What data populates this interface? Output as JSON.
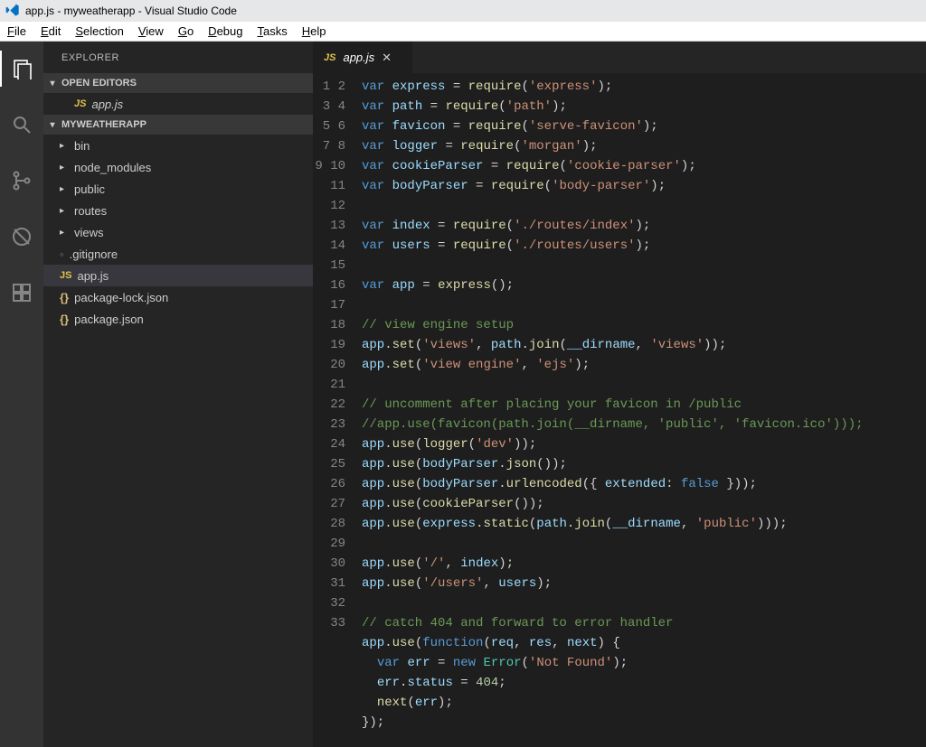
{
  "window": {
    "title": "app.js - myweatherapp - Visual Studio Code"
  },
  "menubar": [
    "File",
    "Edit",
    "Selection",
    "View",
    "Go",
    "Debug",
    "Tasks",
    "Help"
  ],
  "activitybar": [
    "explorer",
    "search",
    "git",
    "debug",
    "extensions"
  ],
  "sidebar": {
    "title": "EXPLORER",
    "open_editors_label": "OPEN EDITORS",
    "open_editors": [
      {
        "icon": "JS",
        "name": "app.js"
      }
    ],
    "project_label": "MYWEATHERAPP",
    "tree": [
      {
        "kind": "folder",
        "name": "bin"
      },
      {
        "kind": "folder",
        "name": "node_modules"
      },
      {
        "kind": "folder",
        "name": "public"
      },
      {
        "kind": "folder",
        "name": "routes"
      },
      {
        "kind": "folder",
        "name": "views"
      },
      {
        "kind": "file",
        "name": ".gitignore",
        "icon": "dot"
      },
      {
        "kind": "file",
        "name": "app.js",
        "icon": "JS",
        "active": true
      },
      {
        "kind": "file",
        "name": "package-lock.json",
        "icon": "braces"
      },
      {
        "kind": "file",
        "name": "package.json",
        "icon": "braces"
      }
    ]
  },
  "editor_tab": {
    "icon": "JS",
    "name": "app.js",
    "close_glyph": "✕"
  },
  "tw_right": "▸",
  "tw_down": "▾",
  "code_lines": [
    [
      [
        "kw",
        "var"
      ],
      [
        "txt",
        " "
      ],
      [
        "var",
        "express"
      ],
      [
        "txt",
        " = "
      ],
      [
        "fn",
        "require"
      ],
      [
        "txt",
        "("
      ],
      [
        "str",
        "'express'"
      ],
      [
        "txt",
        ");"
      ]
    ],
    [
      [
        "kw",
        "var"
      ],
      [
        "txt",
        " "
      ],
      [
        "var",
        "path"
      ],
      [
        "txt",
        " = "
      ],
      [
        "fn",
        "require"
      ],
      [
        "txt",
        "("
      ],
      [
        "str",
        "'path'"
      ],
      [
        "txt",
        ");"
      ]
    ],
    [
      [
        "kw",
        "var"
      ],
      [
        "txt",
        " "
      ],
      [
        "var",
        "favicon"
      ],
      [
        "txt",
        " = "
      ],
      [
        "fn",
        "require"
      ],
      [
        "txt",
        "("
      ],
      [
        "str",
        "'serve-favicon'"
      ],
      [
        "txt",
        ");"
      ]
    ],
    [
      [
        "kw",
        "var"
      ],
      [
        "txt",
        " "
      ],
      [
        "var",
        "logger"
      ],
      [
        "txt",
        " = "
      ],
      [
        "fn",
        "require"
      ],
      [
        "txt",
        "("
      ],
      [
        "str",
        "'morgan'"
      ],
      [
        "txt",
        ");"
      ]
    ],
    [
      [
        "kw",
        "var"
      ],
      [
        "txt",
        " "
      ],
      [
        "var",
        "cookieParser"
      ],
      [
        "txt",
        " = "
      ],
      [
        "fn",
        "require"
      ],
      [
        "txt",
        "("
      ],
      [
        "str",
        "'cookie-parser'"
      ],
      [
        "txt",
        ");"
      ]
    ],
    [
      [
        "kw",
        "var"
      ],
      [
        "txt",
        " "
      ],
      [
        "var",
        "bodyParser"
      ],
      [
        "txt",
        " = "
      ],
      [
        "fn",
        "require"
      ],
      [
        "txt",
        "("
      ],
      [
        "str",
        "'body-parser'"
      ],
      [
        "txt",
        ");"
      ]
    ],
    [],
    [
      [
        "kw",
        "var"
      ],
      [
        "txt",
        " "
      ],
      [
        "var",
        "index"
      ],
      [
        "txt",
        " = "
      ],
      [
        "fn",
        "require"
      ],
      [
        "txt",
        "("
      ],
      [
        "str",
        "'./routes/index'"
      ],
      [
        "txt",
        ");"
      ]
    ],
    [
      [
        "kw",
        "var"
      ],
      [
        "txt",
        " "
      ],
      [
        "var",
        "users"
      ],
      [
        "txt",
        " = "
      ],
      [
        "fn",
        "require"
      ],
      [
        "txt",
        "("
      ],
      [
        "str",
        "'./routes/users'"
      ],
      [
        "txt",
        ");"
      ]
    ],
    [],
    [
      [
        "kw",
        "var"
      ],
      [
        "txt",
        " "
      ],
      [
        "var",
        "app"
      ],
      [
        "txt",
        " = "
      ],
      [
        "fn",
        "express"
      ],
      [
        "txt",
        "();"
      ]
    ],
    [],
    [
      [
        "cmt",
        "// view engine setup"
      ]
    ],
    [
      [
        "var",
        "app"
      ],
      [
        "txt",
        "."
      ],
      [
        "fn",
        "set"
      ],
      [
        "txt",
        "("
      ],
      [
        "str",
        "'views'"
      ],
      [
        "txt",
        ", "
      ],
      [
        "var",
        "path"
      ],
      [
        "txt",
        "."
      ],
      [
        "fn",
        "join"
      ],
      [
        "txt",
        "("
      ],
      [
        "var",
        "__dirname"
      ],
      [
        "txt",
        ", "
      ],
      [
        "str",
        "'views'"
      ],
      [
        "txt",
        "));"
      ]
    ],
    [
      [
        "var",
        "app"
      ],
      [
        "txt",
        "."
      ],
      [
        "fn",
        "set"
      ],
      [
        "txt",
        "("
      ],
      [
        "str",
        "'view engine'"
      ],
      [
        "txt",
        ", "
      ],
      [
        "str",
        "'ejs'"
      ],
      [
        "txt",
        ");"
      ]
    ],
    [],
    [
      [
        "cmt",
        "// uncomment after placing your favicon in /public"
      ]
    ],
    [
      [
        "cmt",
        "//app.use(favicon(path.join(__dirname, 'public', 'favicon.ico')));"
      ]
    ],
    [
      [
        "var",
        "app"
      ],
      [
        "txt",
        "."
      ],
      [
        "fn",
        "use"
      ],
      [
        "txt",
        "("
      ],
      [
        "fn",
        "logger"
      ],
      [
        "txt",
        "("
      ],
      [
        "str",
        "'dev'"
      ],
      [
        "txt",
        "));"
      ]
    ],
    [
      [
        "var",
        "app"
      ],
      [
        "txt",
        "."
      ],
      [
        "fn",
        "use"
      ],
      [
        "txt",
        "("
      ],
      [
        "var",
        "bodyParser"
      ],
      [
        "txt",
        "."
      ],
      [
        "fn",
        "json"
      ],
      [
        "txt",
        "());"
      ]
    ],
    [
      [
        "var",
        "app"
      ],
      [
        "txt",
        "."
      ],
      [
        "fn",
        "use"
      ],
      [
        "txt",
        "("
      ],
      [
        "var",
        "bodyParser"
      ],
      [
        "txt",
        "."
      ],
      [
        "fn",
        "urlencoded"
      ],
      [
        "txt",
        "({ "
      ],
      [
        "var",
        "extended"
      ],
      [
        "txt",
        ": "
      ],
      [
        "kw",
        "false"
      ],
      [
        "txt",
        " }));"
      ]
    ],
    [
      [
        "var",
        "app"
      ],
      [
        "txt",
        "."
      ],
      [
        "fn",
        "use"
      ],
      [
        "txt",
        "("
      ],
      [
        "fn",
        "cookieParser"
      ],
      [
        "txt",
        "());"
      ]
    ],
    [
      [
        "var",
        "app"
      ],
      [
        "txt",
        "."
      ],
      [
        "fn",
        "use"
      ],
      [
        "txt",
        "("
      ],
      [
        "var",
        "express"
      ],
      [
        "txt",
        "."
      ],
      [
        "fn",
        "static"
      ],
      [
        "txt",
        "("
      ],
      [
        "var",
        "path"
      ],
      [
        "txt",
        "."
      ],
      [
        "fn",
        "join"
      ],
      [
        "txt",
        "("
      ],
      [
        "var",
        "__dirname"
      ],
      [
        "txt",
        ", "
      ],
      [
        "str",
        "'public'"
      ],
      [
        "txt",
        ")));"
      ]
    ],
    [],
    [
      [
        "var",
        "app"
      ],
      [
        "txt",
        "."
      ],
      [
        "fn",
        "use"
      ],
      [
        "txt",
        "("
      ],
      [
        "str",
        "'/'"
      ],
      [
        "txt",
        ", "
      ],
      [
        "var",
        "index"
      ],
      [
        "txt",
        ");"
      ]
    ],
    [
      [
        "var",
        "app"
      ],
      [
        "txt",
        "."
      ],
      [
        "fn",
        "use"
      ],
      [
        "txt",
        "("
      ],
      [
        "str",
        "'/users'"
      ],
      [
        "txt",
        ", "
      ],
      [
        "var",
        "users"
      ],
      [
        "txt",
        ");"
      ]
    ],
    [],
    [
      [
        "cmt",
        "// catch 404 and forward to error handler"
      ]
    ],
    [
      [
        "var",
        "app"
      ],
      [
        "txt",
        "."
      ],
      [
        "fn",
        "use"
      ],
      [
        "txt",
        "("
      ],
      [
        "kw",
        "function"
      ],
      [
        "txt",
        "("
      ],
      [
        "var",
        "req"
      ],
      [
        "txt",
        ", "
      ],
      [
        "var",
        "res"
      ],
      [
        "txt",
        ", "
      ],
      [
        "var",
        "next"
      ],
      [
        "txt",
        ") {"
      ]
    ],
    [
      [
        "txt",
        "  "
      ],
      [
        "kw",
        "var"
      ],
      [
        "txt",
        " "
      ],
      [
        "var",
        "err"
      ],
      [
        "txt",
        " = "
      ],
      [
        "kw",
        "new"
      ],
      [
        "txt",
        " "
      ],
      [
        "type",
        "Error"
      ],
      [
        "txt",
        "("
      ],
      [
        "str",
        "'Not Found'"
      ],
      [
        "txt",
        ");"
      ]
    ],
    [
      [
        "txt",
        "  "
      ],
      [
        "var",
        "err"
      ],
      [
        "txt",
        "."
      ],
      [
        "var",
        "status"
      ],
      [
        "txt",
        " = "
      ],
      [
        "num",
        "404"
      ],
      [
        "txt",
        ";"
      ]
    ],
    [
      [
        "txt",
        "  "
      ],
      [
        "fn",
        "next"
      ],
      [
        "txt",
        "("
      ],
      [
        "var",
        "err"
      ],
      [
        "txt",
        ");"
      ]
    ],
    [
      [
        "txt",
        "});"
      ]
    ]
  ]
}
